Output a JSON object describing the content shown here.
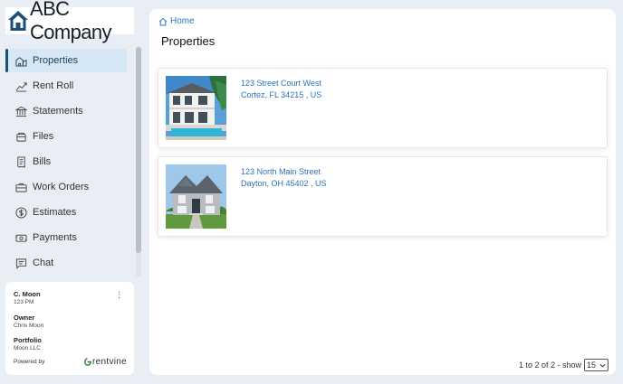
{
  "brand": {
    "name": "ABC Company",
    "icon": "house-logo-icon",
    "color": "#1d4f7c"
  },
  "nav": {
    "items": [
      {
        "label": "Properties",
        "icon": "properties-icon",
        "active": true
      },
      {
        "label": "Rent Roll",
        "icon": "rent-roll-icon"
      },
      {
        "label": "Statements",
        "icon": "statements-icon"
      },
      {
        "label": "Files",
        "icon": "files-icon"
      },
      {
        "label": "Bills",
        "icon": "bills-icon"
      },
      {
        "label": "Work Orders",
        "icon": "work-orders-icon"
      },
      {
        "label": "Estimates",
        "icon": "estimates-icon"
      },
      {
        "label": "Payments",
        "icon": "payments-icon"
      },
      {
        "label": "Chat",
        "icon": "chat-icon"
      }
    ]
  },
  "user": {
    "name": "C. Moon",
    "unit": "123 PM",
    "owner_label": "Owner",
    "owner_value": "Chris Moon",
    "portfolio_label": "Portfolio",
    "portfolio_value": "Moon LLC",
    "powered_by": "Powered by",
    "vendor": "rentvine"
  },
  "breadcrumb": {
    "home": "Home"
  },
  "page": {
    "title": "Properties"
  },
  "properties": [
    {
      "line1": "123 Street Court West",
      "line2": "Cortez, FL 34215 , US"
    },
    {
      "line1": "123 North Main Street",
      "line2": "Dayton, OH 45402 , US"
    }
  ],
  "pagination": {
    "summary": "1 to 2 of 2 - show",
    "page_size": "15"
  },
  "colors": {
    "accent": "#2a73b8",
    "nav_active_bg": "#d6e8f5",
    "background": "#e8eef3"
  }
}
